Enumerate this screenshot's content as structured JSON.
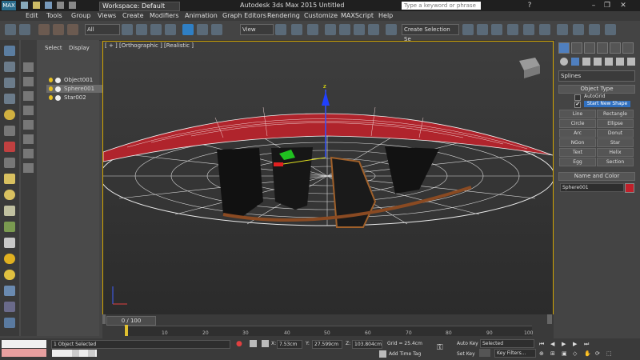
{
  "titlebar": {
    "logo_label": "MAX",
    "workspace": "Workspace: Default",
    "title": "Autodesk 3ds Max  2015      Untitled",
    "search_placeholder": "Type a keyword or phrase"
  },
  "menus": [
    "Edit",
    "Tools",
    "Group",
    "Views",
    "Create",
    "Modifiers",
    "Animation",
    "Graph Editors",
    "Rendering",
    "Customize",
    "MAXScript",
    "Help"
  ],
  "toolbar": {
    "filter": "All",
    "view": "View",
    "selection_set": "Create Selection Se"
  },
  "explorer": {
    "tabs": [
      "Select",
      "Display"
    ],
    "items": [
      "Object001",
      "Sphere001",
      "Star002"
    ],
    "selected_index": 1
  },
  "viewport": {
    "label": "[ + ] [Orthographic ] [Realistic ]"
  },
  "command_panel": {
    "category": "Splines",
    "object_type_header": "Object Type",
    "autogrid": "AutoGrid",
    "start_new_shape": "Start New Shape",
    "buttons": [
      "Line",
      "Rectangle",
      "Circle",
      "Ellipse",
      "Arc",
      "Donut",
      "NGon",
      "Star",
      "Text",
      "Helix",
      "Egg",
      "Section"
    ],
    "name_color_header": "Name and Color",
    "object_name": "Sphere001",
    "object_color": "#c0202a"
  },
  "timeline": {
    "frame_label": "0 / 100",
    "ticks": [
      "10",
      "20",
      "30",
      "40",
      "50",
      "60",
      "70",
      "80",
      "90",
      "100"
    ]
  },
  "status": {
    "selected": "1 Object Selected",
    "x_label": "X:",
    "x_value": "7.53cm",
    "y_label": "Y:",
    "y_value": "27.599cm",
    "z_label": "Z:",
    "z_value": "103.804cm",
    "grid": "Grid = 25.4cm",
    "add_time_tag": "Add Time Tag",
    "auto_key": "Auto Key",
    "auto_key_mode": "Selected",
    "set_key": "Set Key",
    "key_filters": "Key Filters..."
  },
  "colors": {
    "accent": "#2f7fc4",
    "viewport_border": "#d0a400",
    "disc_red": "#b0242c"
  }
}
